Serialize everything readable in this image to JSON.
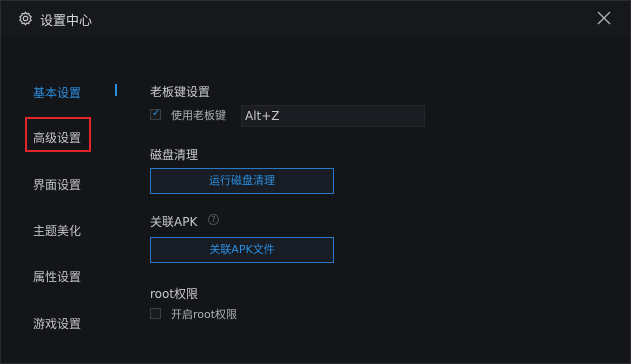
{
  "window": {
    "title": "设置中心",
    "close_icon": "close-icon",
    "settings_icon": "gear-icon"
  },
  "sidebar": {
    "items": [
      {
        "label": "基本设置",
        "active": true
      },
      {
        "label": "高级设置",
        "active": false,
        "highlighted": true
      },
      {
        "label": "界面设置",
        "active": false
      },
      {
        "label": "主题美化",
        "active": false
      },
      {
        "label": "属性设置",
        "active": false
      },
      {
        "label": "游戏设置",
        "active": false
      }
    ]
  },
  "boss_key": {
    "title": "老板键设置",
    "checkbox_label": "使用老板键",
    "checked": true,
    "hotkey": "Alt+Z"
  },
  "disk_cleanup": {
    "title": "磁盘清理",
    "button_label": "运行磁盘清理"
  },
  "apk": {
    "title": "关联APK",
    "help_icon": "question-circle-icon",
    "help_glyph": "?",
    "button_label": "关联APK文件"
  },
  "root": {
    "title": "root权限",
    "checkbox_label": "开启root权限",
    "checked": false
  },
  "colors": {
    "accent": "#2a8fe0",
    "highlight_border": "#e0262b",
    "background": "#141519"
  }
}
